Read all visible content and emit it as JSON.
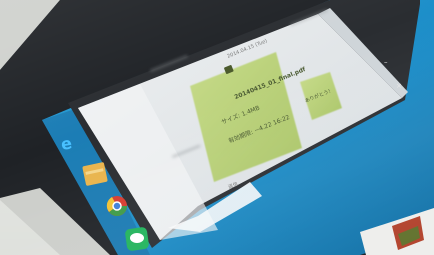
{
  "chat_window": {
    "date_separator": "2014.04.15 (Tue)",
    "attachment": {
      "file_name": "20140415_01_final.pdf",
      "size_line": "サイズ: 1.4MB",
      "expiry_line": "有効期限: ~4.22 16:22"
    },
    "reply_bubble": "ありがとう！",
    "input_placeholder": "送信",
    "minimize_icon": "–",
    "close_icon": "×"
  },
  "taskbar": {
    "icons": [
      "ie-icon",
      "file-explorer-icon",
      "chrome-icon",
      "line-icon"
    ]
  },
  "colors": {
    "desktop_blue": "#1d9bd4",
    "chat_bg": "#e9ecef",
    "bubble_green": "#b9d17a",
    "bezel": "#222428",
    "room_wall": "#d9dcd8"
  }
}
